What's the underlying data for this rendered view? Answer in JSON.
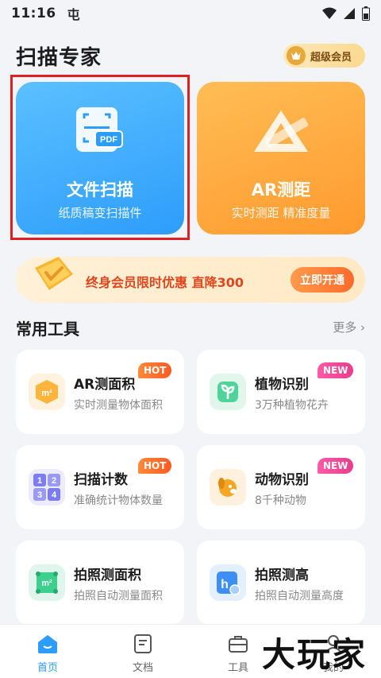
{
  "status_bar": {
    "time": "11:16",
    "carrier_glyph": "屯",
    "icons": [
      "wifi-icon",
      "signal-icon",
      "battery-icon"
    ]
  },
  "header": {
    "title": "扫描专家",
    "vip_label": "超级会员"
  },
  "feature_cards": [
    {
      "title": "文件扫描",
      "subtitle": "纸质稿变扫描件",
      "icon_label": "PDF",
      "icon": "pdf-scan-icon",
      "color": "#2d9dfb"
    },
    {
      "title": "AR测距",
      "subtitle": "实时测距 精准度量",
      "icon": "ruler-triangle-icon",
      "color": "#ff9a2e"
    }
  ],
  "promo": {
    "text": "终身会员限时优惠 直降300",
    "button": "立即开通"
  },
  "tools_section": {
    "title": "常用工具",
    "more": "更多"
  },
  "tools": [
    {
      "title": "AR测面积",
      "desc": "实时测量物体面积",
      "tag": "HOT",
      "icon": "area-cube-icon",
      "icon_text": "m²"
    },
    {
      "title": "植物识别",
      "desc": "3万种植物花卉",
      "tag": "NEW",
      "icon": "plant-sprout-icon"
    },
    {
      "title": "扫描计数",
      "desc": "准确统计物体数量",
      "tag": "HOT",
      "icon": "number-grid-icon",
      "icon_text": [
        "1",
        "2",
        "3",
        "4"
      ]
    },
    {
      "title": "动物识别",
      "desc": "8千种动物",
      "tag": "NEW",
      "icon": "dog-icon"
    },
    {
      "title": "拍照测面积",
      "desc": "拍照自动测量面积",
      "tag": "",
      "icon": "photo-area-icon",
      "icon_text": "m²"
    },
    {
      "title": "拍照测高",
      "desc": "拍照自动测量高度",
      "tag": "",
      "icon": "photo-height-icon",
      "icon_text": "h"
    }
  ],
  "tabbar": [
    {
      "label": "首页",
      "icon": "home-icon",
      "active": true
    },
    {
      "label": "文档",
      "icon": "document-icon",
      "active": false
    },
    {
      "label": "工具",
      "icon": "toolbox-icon",
      "active": false
    },
    {
      "label": "我的",
      "icon": "profile-icon",
      "active": false
    }
  ],
  "watermark": "大玩家",
  "colors": {
    "accent_blue": "#2d9dfb",
    "accent_orange": "#ff9a2e",
    "hot_tag": "#ff5a22",
    "new_tag": "#e83c8c",
    "highlight_border": "#e02020"
  }
}
